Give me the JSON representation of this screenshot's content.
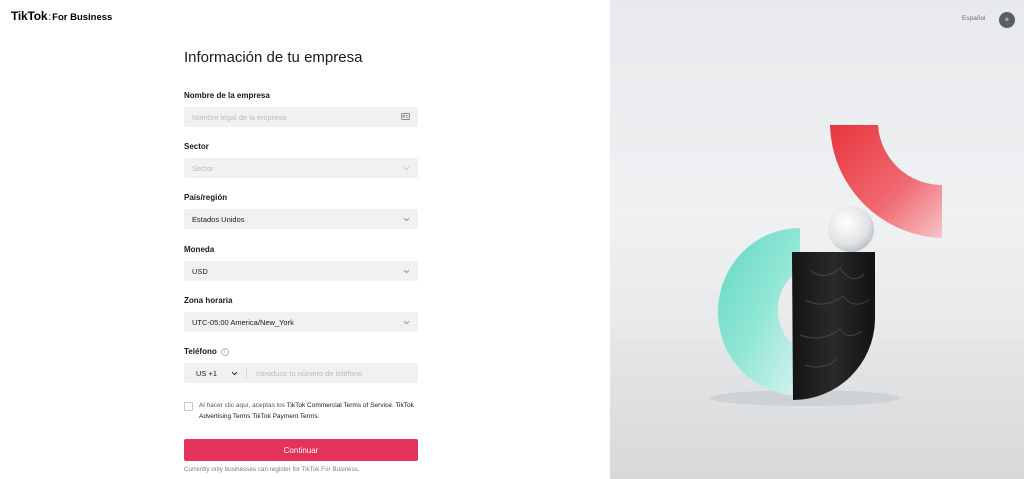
{
  "brand": {
    "name": "TikTok",
    "separator": ":",
    "suffix": "For Business"
  },
  "header": {
    "language": "Español",
    "avatar_initial": "e"
  },
  "form": {
    "title": "Información de tu empresa",
    "company_name": {
      "label": "Nombre de la empresa",
      "placeholder": "Nombre legal de la empresa"
    },
    "sector": {
      "label": "Sector",
      "placeholder": "Sector"
    },
    "country": {
      "label": "País/región",
      "value": "Estados Unidos"
    },
    "currency": {
      "label": "Moneda",
      "value": "USD"
    },
    "timezone": {
      "label": "Zona horaria",
      "value": "UTC-05:00 America/New_York"
    },
    "phone": {
      "label": "Teléfono",
      "info": "i",
      "country_code": "US +1",
      "placeholder": "Introduce tu número de teléfono"
    },
    "terms": {
      "prefix": "Al hacer clic aquí, aceptas los",
      "link1": "TikTok Commercial Terms of Service",
      "link2": "TikTok Advertising Terms",
      "link3": "TikTok Payment Terms"
    },
    "submit_label": "Continuar",
    "footnote": "Currently only businesses can register for TikTok For Business."
  },
  "colors": {
    "primary": "#e5325a",
    "field_bg": "#f1f1f2",
    "text": "#161823"
  }
}
